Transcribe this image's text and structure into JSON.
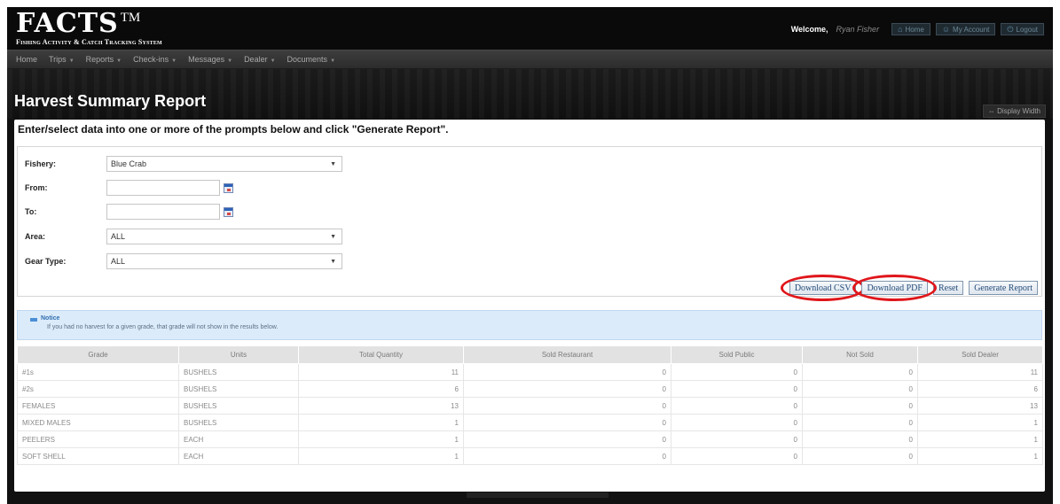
{
  "header": {
    "logo_main": "FACTS",
    "logo_tm": "TM",
    "logo_subtitle": "Fishing Activity & Catch Tracking System",
    "welcome": "Welcome,",
    "user_name": "Ryan Fisher",
    "buttons": [
      {
        "label": "Home",
        "icon": "home-icon"
      },
      {
        "label": "My Account",
        "icon": "user-icon"
      },
      {
        "label": "Logout",
        "icon": "power-icon"
      }
    ]
  },
  "nav": {
    "items": [
      {
        "label": "Home",
        "has_menu": false
      },
      {
        "label": "Trips",
        "has_menu": true
      },
      {
        "label": "Reports",
        "has_menu": true
      },
      {
        "label": "Check-ins",
        "has_menu": true
      },
      {
        "label": "Messages",
        "has_menu": true
      },
      {
        "label": "Dealer",
        "has_menu": true
      },
      {
        "label": "Documents",
        "has_menu": true
      }
    ]
  },
  "page": {
    "title": "Harvest Summary Report",
    "display_width": "Display Width"
  },
  "form": {
    "instructions": "Enter/select data into one or more of the prompts below and click \"Generate Report\".",
    "fishery_label": "Fishery:",
    "fishery_value": "Blue Crab",
    "from_label": "From:",
    "from_value": "",
    "to_label": "To:",
    "to_value": "",
    "area_label": "Area:",
    "area_value": "ALL",
    "gear_label": "Gear Type:",
    "gear_value": "ALL",
    "buttons": {
      "download_csv": "Download CSV",
      "download_pdf": "Download PDF",
      "reset": "Reset",
      "generate": "Generate Report"
    }
  },
  "notice": {
    "title": "Notice",
    "text": "If you had no harvest for a given grade, that grade will not show in the results below."
  },
  "table": {
    "headers": [
      "Grade",
      "Units",
      "Total Quantity",
      "Sold Restaurant",
      "Sold Public",
      "Not Sold",
      "Sold Dealer"
    ],
    "rows": [
      [
        "#1s",
        "BUSHELS",
        "11",
        "0",
        "0",
        "0",
        "11"
      ],
      [
        "#2s",
        "BUSHELS",
        "6",
        "0",
        "0",
        "0",
        "6"
      ],
      [
        "FEMALES",
        "BUSHELS",
        "13",
        "0",
        "0",
        "0",
        "13"
      ],
      [
        "MIXED MALES",
        "BUSHELS",
        "1",
        "0",
        "0",
        "0",
        "1"
      ],
      [
        "PEELERS",
        "EACH",
        "1",
        "0",
        "0",
        "0",
        "1"
      ],
      [
        "SOFT SHELL",
        "EACH",
        "1",
        "0",
        "0",
        "0",
        "1"
      ]
    ]
  },
  "colors": {
    "accent": "#254c7a",
    "highlight_circle": "#e0161b",
    "notice_bg": "#dcebfa"
  }
}
